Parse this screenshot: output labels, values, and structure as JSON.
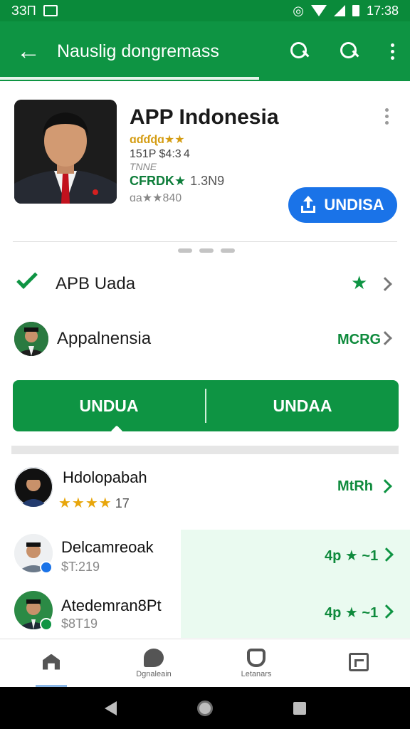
{
  "status_bar": {
    "left_text": "ЗЗП",
    "time": "17:38",
    "icons": [
      "image-icon",
      "vibrate-icon",
      "wifi-icon",
      "signal-icon",
      "battery-icon"
    ]
  },
  "app_bar": {
    "title": "Nauslig dongremass",
    "icons": [
      "back-arrow-icon",
      "search-icon",
      "search-icon",
      "more-vert-icon"
    ]
  },
  "app": {
    "name": "APP Indonesia",
    "meta1": "ɑɗɗɖɑ★★",
    "meta2": "151P $4:3 4",
    "meta3": "TNNE",
    "meta4": "CFRDK★",
    "meta4_sub": "1.3N9",
    "meta5": "ɑa★★840",
    "install_label": "UNDISA"
  },
  "rows": [
    {
      "label": "APB Uada",
      "icon": "check-icon"
    },
    {
      "label": "Appalnensia",
      "right_text": "MCRG"
    }
  ],
  "double_button": {
    "left": "UNDUA",
    "right": "UNDAA"
  },
  "list": [
    {
      "title": "Hdolopabah",
      "stars": "★★★★",
      "count": "17",
      "right_text": "MtRh"
    },
    {
      "title": "Delcamreoak",
      "sub": "$T:219",
      "right_text": "4p ★ ~1"
    },
    {
      "title": "Atedemran8Pt",
      "sub": "$8T19",
      "right_text": "4p ★ ~1"
    }
  ],
  "bottom_nav": [
    {
      "label": "",
      "icon": "home-icon"
    },
    {
      "label": "Dgnaleain",
      "icon": "chat-icon"
    },
    {
      "label": "Letanars",
      "icon": "bag-icon"
    },
    {
      "label": "",
      "icon": "frame-icon"
    }
  ],
  "colors": {
    "primary": "#0e9443",
    "accent_blue": "#1a73e8",
    "mint": "#eafaf0"
  }
}
